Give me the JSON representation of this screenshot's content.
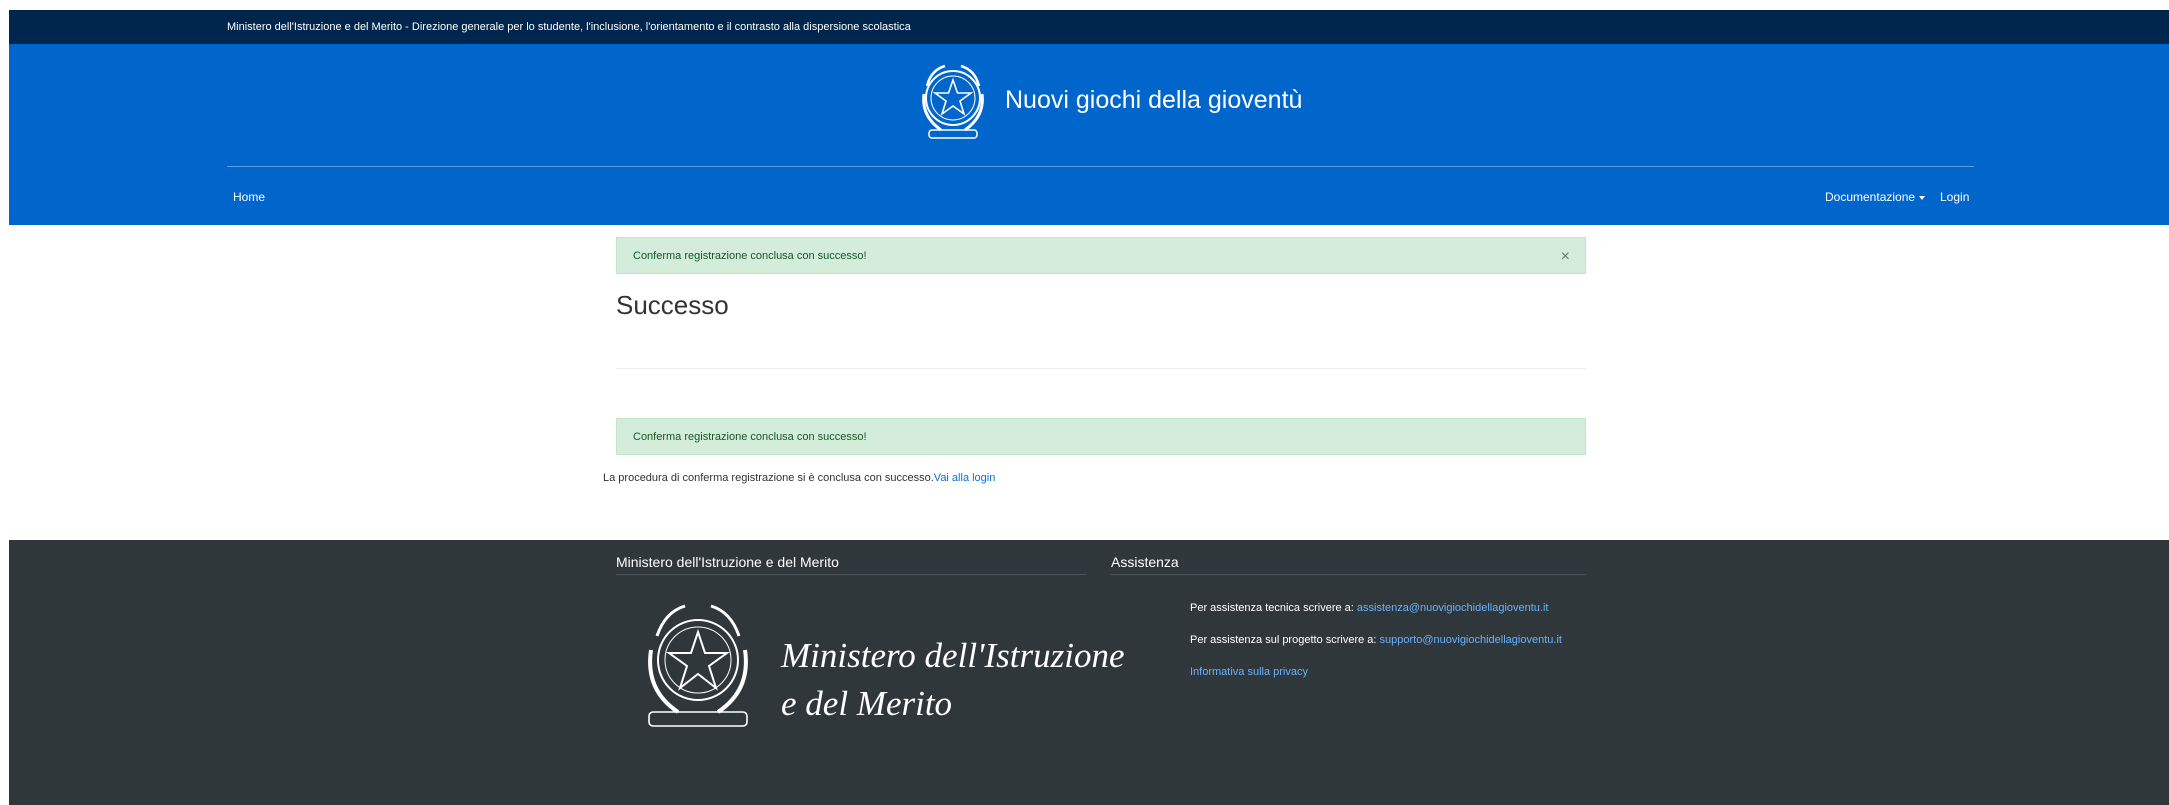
{
  "topbar": {
    "text": "Ministero dell'Istruzione e del Merito - Direzione generale per lo studente, l'inclusione, l'orientamento e il contrasto alla dispersione scolastica"
  },
  "header": {
    "title": "Nuovi giochi della gioventù",
    "nav": {
      "home": "Home",
      "documentation": "Documentazione",
      "login": "Login"
    }
  },
  "main": {
    "alert_top": "Conferma registrazione conclusa con successo!",
    "close_symbol": "×",
    "title": "Successo",
    "alert_bottom": "Conferma registrazione conclusa con successo!",
    "info_text": "La procedura di conferma registrazione si è conclusa con successo.",
    "info_link": "Vai alla login"
  },
  "footer": {
    "left_title": "Ministero dell'Istruzione e del Merito",
    "ministry_line1": "Ministero dell'Istruzione",
    "ministry_line2": "e del Merito",
    "right_title": "Assistenza",
    "tech_label": "Per assistenza tecnica scrivere a:",
    "tech_email": "assistenza@nuovigiochidellagioventu.it",
    "project_label": "Per assistenza sul progetto scrivere a:",
    "project_email": "supporto@nuovigiochidellagioventu.it",
    "privacy": "Informativa sulla privacy"
  },
  "colors": {
    "topbar": "#00264d",
    "header": "#0066cc",
    "alert_bg": "#d4edda",
    "footer": "#30373b",
    "link": "#0a6fd6"
  }
}
